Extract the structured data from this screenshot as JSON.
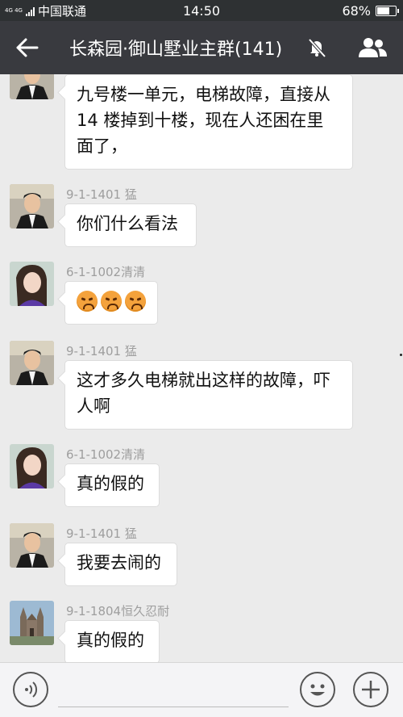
{
  "status_bar": {
    "network": "4G 4G",
    "carrier": "中国联通",
    "time": "14:50",
    "battery": "68%",
    "battery_level": 0.68
  },
  "header": {
    "back_icon": "arrow-left-icon",
    "title": "长森园·御山墅业主群(141)",
    "mute_icon": "bell-muted-icon",
    "members_icon": "group-members-icon"
  },
  "messages": [
    {
      "sender": "",
      "avatar": "man-avatar",
      "lines": [
        "九号楼一单元，电梯故障，直接从",
        "14 楼掉到十楼，现在人还困在里",
        "面了，"
      ]
    },
    {
      "sender": "9-1-1401 猛",
      "avatar": "man-avatar",
      "lines": [
        "你们什么看法"
      ]
    },
    {
      "sender": "6-1-1002清清",
      "avatar": "woman-avatar",
      "lines": [],
      "emojis": [
        "angry-face-emoji",
        "angry-face-emoji",
        "angry-face-emoji"
      ]
    },
    {
      "sender": "9-1-1401 猛",
      "avatar": "man-avatar",
      "lines": [
        "这才多久电梯就出这样的故障，吓",
        "人啊"
      ]
    },
    {
      "sender": "6-1-1002清清",
      "avatar": "woman-avatar",
      "lines": [
        "真的假的"
      ]
    },
    {
      "sender": "9-1-1401 猛",
      "avatar": "man-avatar",
      "lines": [
        "我要去闹的"
      ]
    },
    {
      "sender": "9-1-1804恒久忍耐",
      "avatar": "church-avatar",
      "lines": [
        "真的假的"
      ]
    }
  ],
  "input_bar": {
    "voice_icon": "voice-icon",
    "emoji_icon": "smiley-icon",
    "more_icon": "plus-icon"
  }
}
